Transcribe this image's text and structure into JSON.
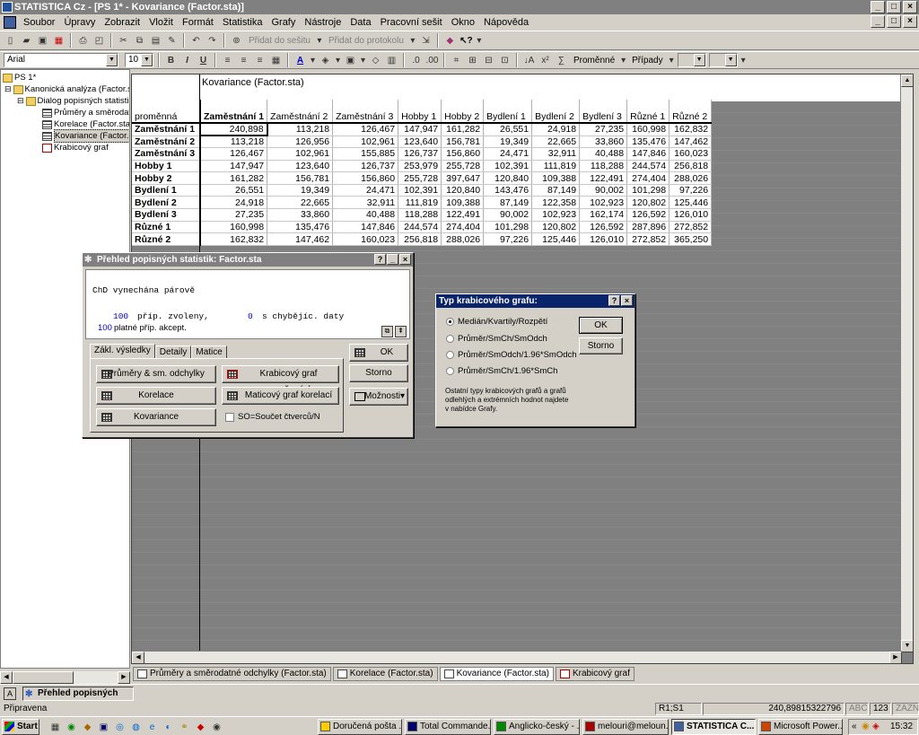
{
  "window": {
    "title": "STATISTICA Cz - [PS 1* - Kovariance (Factor.sta)]"
  },
  "menu": [
    "Soubor",
    "Úpravy",
    "Zobrazit",
    "Vložit",
    "Formát",
    "Statistika",
    "Grafy",
    "Nástroje",
    "Data",
    "Pracovní sešit",
    "Okno",
    "Nápověda"
  ],
  "toolbar1": {
    "add_workbook": "Přidat do sešitu",
    "add_report": "Přidat do protokolu"
  },
  "toolbar2": {
    "font": "Arial",
    "size": "10",
    "vars": "Proměnné",
    "cases": "Případy"
  },
  "tree": {
    "root": "PS 1*",
    "n1": "Kanonická analýza (Factor.st",
    "n2": "Dialog popisných statistik",
    "n3": "Průměry a směrodatn",
    "n4": "Korelace (Factor.sta",
    "n5": "Kovariance (Factor.s",
    "n6": "Krabicový graf"
  },
  "sheet": {
    "title": "Kovariance (Factor.sta)",
    "corner": "proměnná",
    "columns": [
      "Zaměstnání 1",
      "Zaměstnání 2",
      "Zaměstnání 3",
      "Hobby 1",
      "Hobby 2",
      "Bydlení 1",
      "Bydlení 2",
      "Bydlení 3",
      "Různé 1",
      "Různé 2"
    ],
    "rows": [
      {
        "name": "Zaměstnání 1",
        "v": [
          "240,898",
          "113,218",
          "126,467",
          "147,947",
          "161,282",
          "26,551",
          "24,918",
          "27,235",
          "160,998",
          "162,832"
        ]
      },
      {
        "name": "Zaměstnání 2",
        "v": [
          "113,218",
          "126,956",
          "102,961",
          "123,640",
          "156,781",
          "19,349",
          "22,665",
          "33,860",
          "135,476",
          "147,462"
        ]
      },
      {
        "name": "Zaměstnání 3",
        "v": [
          "126,467",
          "102,961",
          "155,885",
          "126,737",
          "156,860",
          "24,471",
          "32,911",
          "40,488",
          "147,846",
          "160,023"
        ]
      },
      {
        "name": "Hobby 1",
        "v": [
          "147,947",
          "123,640",
          "126,737",
          "253,979",
          "255,728",
          "102,391",
          "111,819",
          "118,288",
          "244,574",
          "256,818"
        ]
      },
      {
        "name": "Hobby 2",
        "v": [
          "161,282",
          "156,781",
          "156,860",
          "255,728",
          "397,647",
          "120,840",
          "109,388",
          "122,491",
          "274,404",
          "288,026"
        ]
      },
      {
        "name": "Bydlení 1",
        "v": [
          "26,551",
          "19,349",
          "24,471",
          "102,391",
          "120,840",
          "143,476",
          "87,149",
          "90,002",
          "101,298",
          "97,226"
        ]
      },
      {
        "name": "Bydlení 2",
        "v": [
          "24,918",
          "22,665",
          "32,911",
          "111,819",
          "109,388",
          "87,149",
          "122,358",
          "102,923",
          "120,802",
          "125,446"
        ]
      },
      {
        "name": "Bydlení 3",
        "v": [
          "27,235",
          "33,860",
          "40,488",
          "118,288",
          "122,491",
          "90,002",
          "102,923",
          "162,174",
          "126,592",
          "126,010"
        ]
      },
      {
        "name": "Různé 1",
        "v": [
          "160,998",
          "135,476",
          "147,846",
          "244,574",
          "274,404",
          "101,298",
          "120,802",
          "126,592",
          "287,896",
          "272,852"
        ]
      },
      {
        "name": "Různé 2",
        "v": [
          "162,832",
          "147,462",
          "160,023",
          "256,818",
          "288,026",
          "97,226",
          "125,446",
          "126,010",
          "272,852",
          "365,250"
        ]
      }
    ]
  },
  "sheettabs": [
    "Průměry a směrodatné odchylky (Factor.sta)",
    "Korelace (Factor.sta)",
    "Kovariance (Factor.sta)",
    "Krabicový graf"
  ],
  "desc_dialog": {
    "title": "Přehled popisných statistik: Factor.sta",
    "line1": "ChD vynechána párově",
    "n_sel": "100",
    "sel_txt": "příp. zvoleny,",
    "n_miss": "0",
    "miss_txt": "s chybějíc. daty",
    "n_acc": "100",
    "acc_txt": "platné příp. akcept.",
    "tabs": [
      "Zákl. výsledky",
      "Detaily",
      "Matice"
    ],
    "b_means": "Průměry & sm. odchylky",
    "b_box": "Krabicový graf proměnných",
    "b_corr": "Korelace",
    "b_matrix": "Maticový graf korelací",
    "b_cov": "Kovariance",
    "chk_ss": "SO=Součet čtverců/N",
    "ok": "OK",
    "cancel": "Storno",
    "options": "Možnosti"
  },
  "box_dialog": {
    "title": "Typ krabicového grafu:",
    "options": [
      "Medián/Kvartily/Rozpětí",
      "Průměr/SmCh/SmOdch",
      "Průměr/SmOdch/1.96*SmOdch",
      "Průměr/SmCh/1.96*SmCh"
    ],
    "note": "Ostatní typy krabicových grafů a grafů odlehlých a extrémních hodnot najdete v nabídce Grafy.",
    "ok": "OK",
    "cancel": "Storno"
  },
  "taskstrip": {
    "item": "Přehled popisných st..."
  },
  "status": {
    "ready": "Připravena",
    "cell": "R1;S1",
    "value": "240,89815322796",
    "abc": "ABC",
    "n123": "123",
    "zazn": "ZÁZN"
  },
  "taskbar": {
    "start": "Start",
    "items": [
      "Doručená pošta ...",
      "Total Commande...",
      "Anglicko-český - ...",
      "melouri@meloun...",
      "STATISTICA C...",
      "Microsoft Power..."
    ],
    "time": "15:32"
  }
}
